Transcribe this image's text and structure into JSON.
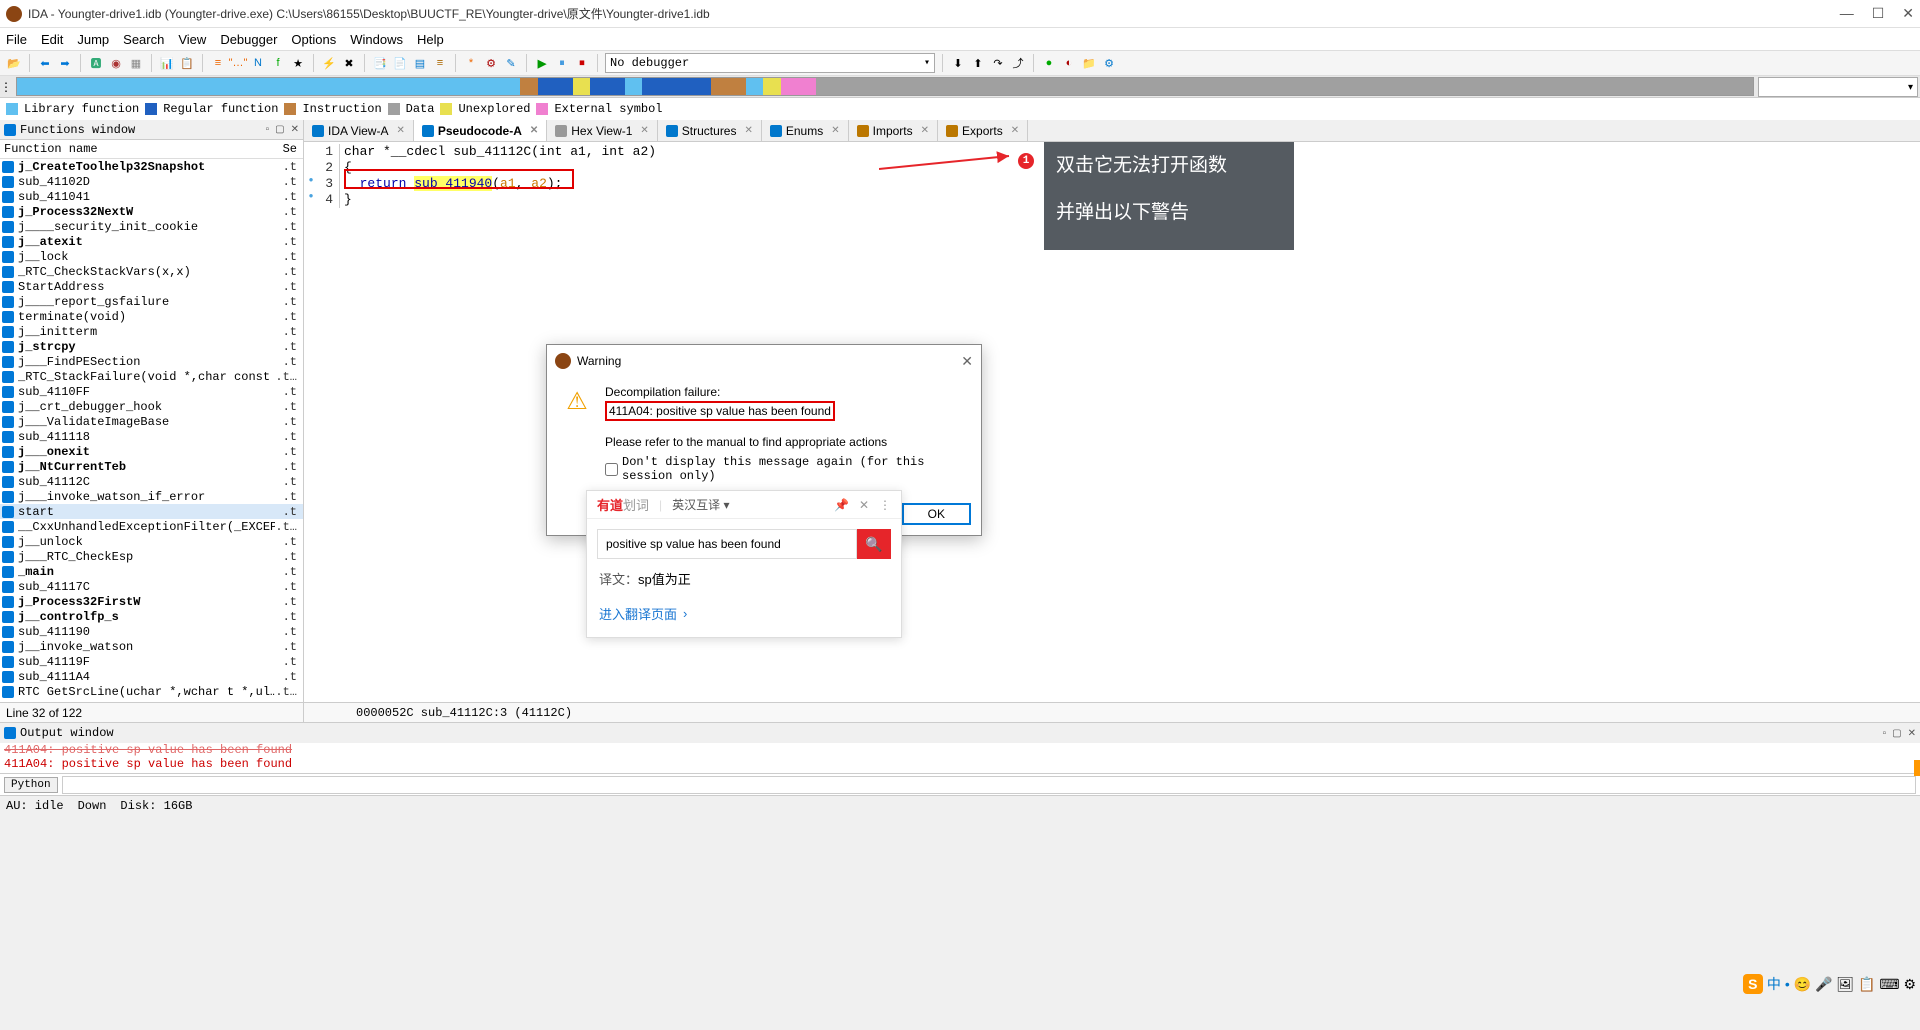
{
  "titlebar": {
    "title": "IDA - Youngter-drive1.idb (Youngter-drive.exe) C:\\Users\\86155\\Desktop\\BUUCTF_RE\\Youngter-drive\\原文件\\Youngter-drive1.idb"
  },
  "menu": {
    "file": "File",
    "edit": "Edit",
    "jump": "Jump",
    "search": "Search",
    "view": "View",
    "debugger": "Debugger",
    "options": "Options",
    "windows": "Windows",
    "help": "Help"
  },
  "toolbar": {
    "debugger_combo": "No debugger"
  },
  "legend": {
    "lib": "Library function",
    "reg": "Regular function",
    "ins": "Instruction",
    "data": "Data",
    "unexp": "Unexplored",
    "ext": "External symbol"
  },
  "functions_panel": {
    "title": "Functions window",
    "col_name": "Function name",
    "col_seg": "Se",
    "seg_text": ".t",
    "seg_text_trunc": ".t…",
    "items": [
      {
        "n": "j_CreateToolhelp32Snapshot",
        "b": true
      },
      {
        "n": "sub_41102D"
      },
      {
        "n": "sub_411041"
      },
      {
        "n": "j_Process32NextW",
        "b": true
      },
      {
        "n": "j____security_init_cookie"
      },
      {
        "n": "j__atexit",
        "b": true
      },
      {
        "n": "j__lock"
      },
      {
        "n": "_RTC_CheckStackVars(x,x)"
      },
      {
        "n": "StartAddress"
      },
      {
        "n": "j____report_gsfailure"
      },
      {
        "n": "terminate(void)"
      },
      {
        "n": "j__initterm"
      },
      {
        "n": "j_strcpy",
        "b": true
      },
      {
        "n": "j___FindPESection"
      },
      {
        "n": "_RTC_StackFailure(void *,char const *)",
        "se": ".t…"
      },
      {
        "n": "sub_4110FF"
      },
      {
        "n": "j__crt_debugger_hook"
      },
      {
        "n": "j___ValidateImageBase"
      },
      {
        "n": "sub_411118"
      },
      {
        "n": "j___onexit",
        "b": true
      },
      {
        "n": "j__NtCurrentTeb",
        "b": true
      },
      {
        "n": "sub_41112C"
      },
      {
        "n": "j___invoke_watson_if_error"
      },
      {
        "n": "start",
        "sel": true
      },
      {
        "n": "__CxxUnhandledExceptionFilter(_EXCEP…",
        "se": ".t…"
      },
      {
        "n": "j__unlock"
      },
      {
        "n": "j___RTC_CheckEsp"
      },
      {
        "n": "_main",
        "b": true
      },
      {
        "n": "sub_41117C"
      },
      {
        "n": "j_Process32FirstW",
        "b": true
      },
      {
        "n": "j__controlfp_s",
        "b": true
      },
      {
        "n": "sub_411190"
      },
      {
        "n": "j__invoke_watson"
      },
      {
        "n": "sub_41119F"
      },
      {
        "n": "sub_4111A4"
      },
      {
        "n": "RTC GetSrcLine(uchar *,wchar t *,ul…",
        "se": ".t…"
      }
    ],
    "status": "Line 32 of 122"
  },
  "tabs": {
    "ida_view": "IDA View-A",
    "pseudo": "Pseudocode-A",
    "hex": "Hex View-1",
    "struct": "Structures",
    "enums": "Enums",
    "imports": "Imports",
    "exports": "Exports"
  },
  "code": {
    "l1": "char *__cdecl sub_41112C(int a1, int a2)",
    "l2": "{",
    "l3_ret": "return ",
    "l3_fn": "sub_411940",
    "l3_open": "(",
    "l3_a1": "a1",
    "l3_c": ", ",
    "l3_a2": "a2",
    "l3_close": ");",
    "l4": "}",
    "status": "0000052C sub_41112C:3 (41112C)"
  },
  "annotation": {
    "line1": "双击它无法打开函数",
    "line2": "并弹出以下警告",
    "badge": "1"
  },
  "dialog": {
    "title": "Warning",
    "msg1": "Decompilation failure:",
    "msg2": "411A04: positive sp value has been found",
    "refer": "Please refer to the manual to find appropriate actions",
    "chk": "Don't display this message again (for this session only)",
    "ok": "OK"
  },
  "trans": {
    "logo_red": "有道",
    "logo_grey": "划词",
    "mode": "英汉互译",
    "input": "positive sp value has been found",
    "result_lbl": "译文：",
    "result": "sp值为正",
    "link": "进入翻译页面"
  },
  "output": {
    "title": "Output window",
    "l1_partial": "411A04: positive sp value has been found",
    "l2": "411A04: positive sp value has been found"
  },
  "python": {
    "label": "Python"
  },
  "bottom": {
    "au": "AU: idle",
    "down": "Down",
    "disk": "Disk: 16GB"
  },
  "ime": {
    "zh": "中",
    "icons": "😊 🎤 🖼 📋 ⌨ ⚙"
  }
}
